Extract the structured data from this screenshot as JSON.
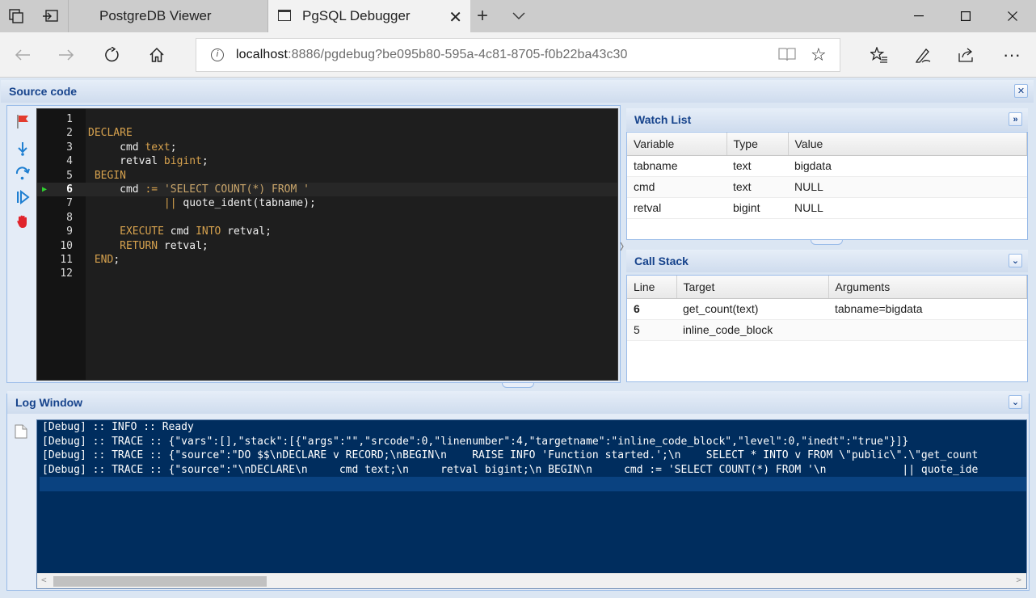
{
  "browser": {
    "tabs": [
      {
        "title": "PostgreDB Viewer",
        "active": false
      },
      {
        "title": "PgSQL Debugger",
        "active": true
      }
    ],
    "url_host": "localhost",
    "url_rest": ":8886/pgdebug?be095b80-595a-4c81-8705-f0b22ba43c30"
  },
  "source": {
    "title": "Source code",
    "current_line": 6,
    "lines": [
      {
        "n": "1",
        "code": ""
      },
      {
        "n": "2",
        "code": "DECLARE"
      },
      {
        "n": "3",
        "code": "     cmd text;"
      },
      {
        "n": "4",
        "code": "     retval bigint;"
      },
      {
        "n": "5",
        "code": " BEGIN"
      },
      {
        "n": "6",
        "code": "     cmd := 'SELECT COUNT(*) FROM '"
      },
      {
        "n": "7",
        "code": "            || quote_ident(tabname);"
      },
      {
        "n": "8",
        "code": ""
      },
      {
        "n": "9",
        "code": "     EXECUTE cmd INTO retval;"
      },
      {
        "n": "10",
        "code": "     RETURN retval;"
      },
      {
        "n": "11",
        "code": " END;"
      },
      {
        "n": "12",
        "code": ""
      }
    ]
  },
  "watch": {
    "title": "Watch List",
    "columns": [
      "Variable",
      "Type",
      "Value"
    ],
    "rows": [
      [
        "tabname",
        "text",
        "bigdata"
      ],
      [
        "cmd",
        "text",
        "NULL"
      ],
      [
        "retval",
        "bigint",
        "NULL"
      ]
    ]
  },
  "callstack": {
    "title": "Call Stack",
    "columns": [
      "Line",
      "Target",
      "Arguments"
    ],
    "rows": [
      [
        "6",
        "get_count(text)",
        "tabname=bigdata"
      ],
      [
        "5",
        "inline_code_block",
        ""
      ]
    ]
  },
  "log": {
    "title": "Log Window",
    "lines": [
      "[Debug] :: INFO :: Ready",
      "[Debug] :: TRACE :: {\"vars\":[],\"stack\":[{\"args\":\"\",\"srcode\":0,\"linenumber\":4,\"targetname\":\"inline_code_block\",\"level\":0,\"inedt\":\"true\"}]}",
      "[Debug] :: TRACE :: {\"source\":\"DO $$\\nDECLARE v RECORD;\\nBEGIN\\n    RAISE INFO 'Function started.';\\n    SELECT * INTO v FROM \\\"public\\\".\\\"get_count",
      "[Debug] :: TRACE :: {\"source\":\"\\nDECLARE\\n     cmd text;\\n     retval bigint;\\n BEGIN\\n     cmd := 'SELECT COUNT(*) FROM '\\n            || quote_ide"
    ]
  },
  "icons": {
    "toolbar": [
      "toggle-breakpoint-icon",
      "step-into-icon",
      "step-over-icon",
      "continue-icon",
      "stop-icon"
    ]
  },
  "colors": {
    "panel_header_text": "#15428b",
    "editor_bg": "#1e1e1e",
    "log_bg": "#002d5e",
    "keyword": "#d7a24e",
    "current_line_arrow": "#2fd12f"
  }
}
